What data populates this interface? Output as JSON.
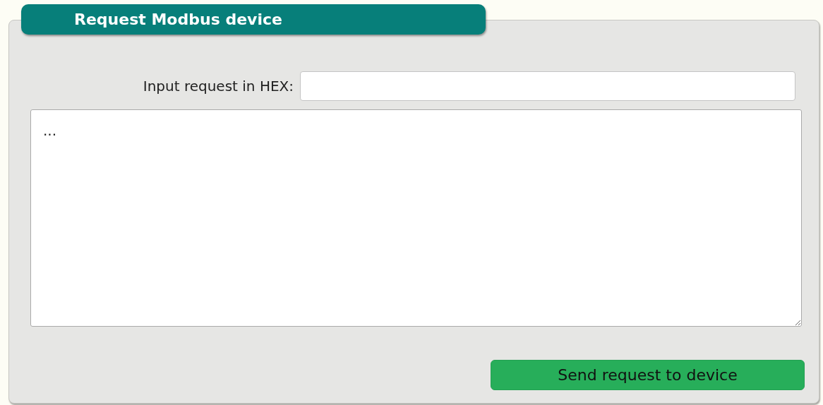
{
  "panel": {
    "title": "Request Modbus device"
  },
  "hex_input": {
    "label": "Input request in HEX:"
  },
  "response_area": {
    "value": "..."
  },
  "send_button": {
    "label": "Send request to device"
  }
}
